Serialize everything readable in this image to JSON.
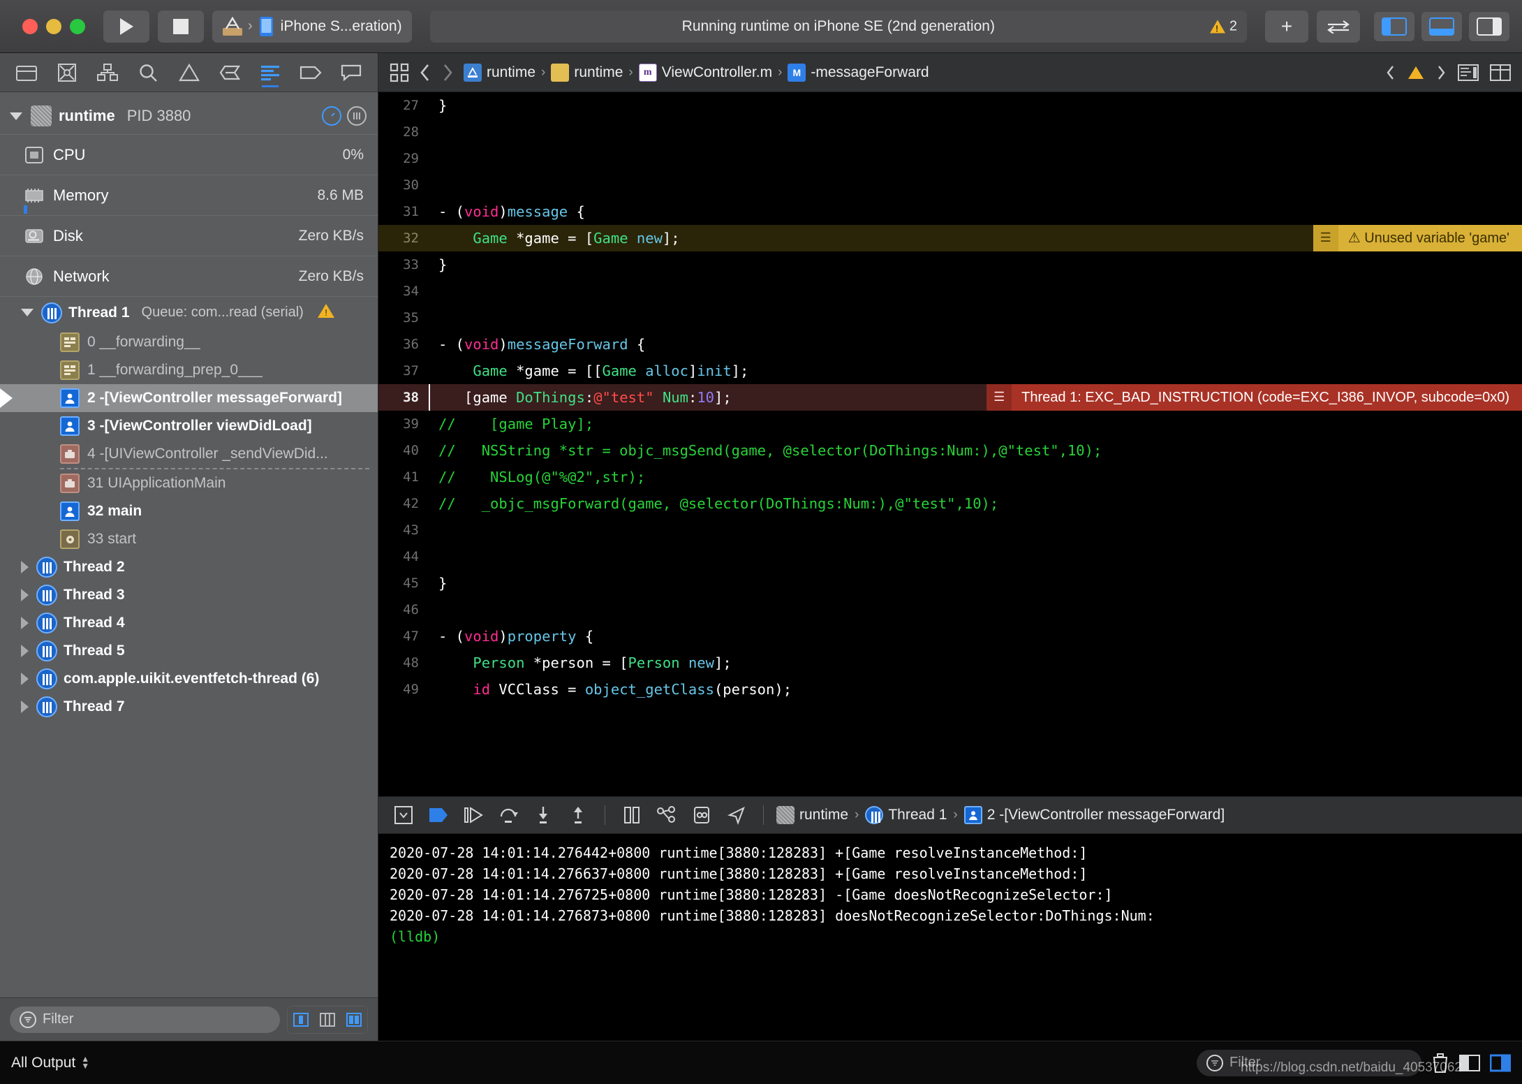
{
  "titlebar": {
    "play_icon": "play-icon",
    "stop_icon": "stop-icon",
    "scheme_name": "iPhone S...eration)",
    "status_text": "Running runtime on iPhone SE (2nd generation)",
    "warning_count": "2",
    "add_label": "+",
    "swap_icon": "swap-icon"
  },
  "navigator": {
    "toolbar_icons": [
      "folder-icon",
      "source-control-icon",
      "hierarchy-icon",
      "search-icon",
      "warning-icon",
      "breakpoint-icon",
      "debug-icon",
      "bookmark-icon",
      "comment-icon"
    ],
    "process": {
      "name": "runtime",
      "pid": "PID 3880"
    },
    "gauges": [
      {
        "label": "CPU",
        "value": "0%",
        "icon": "cpu-icon"
      },
      {
        "label": "Memory",
        "value": "8.6 MB",
        "icon": "memory-icon"
      },
      {
        "label": "Disk",
        "value": "Zero KB/s",
        "icon": "disk-icon"
      },
      {
        "label": "Network",
        "value": "Zero KB/s",
        "icon": "network-icon"
      }
    ],
    "thread1": {
      "name": "Thread 1",
      "queue": "Queue: com...read (serial)"
    },
    "frames": [
      {
        "index": "0",
        "label": "__forwarding__",
        "kind": "lib",
        "dim": true
      },
      {
        "index": "1",
        "label": "__forwarding_prep_0___",
        "kind": "lib",
        "dim": true
      },
      {
        "index": "2",
        "label": "-[ViewController messageForward]",
        "kind": "user",
        "dim": false,
        "selected": true
      },
      {
        "index": "3",
        "label": "-[ViewController viewDidLoad]",
        "kind": "user",
        "dim": false
      },
      {
        "index": "4",
        "label": "-[UIViewController _sendViewDid...",
        "kind": "sys",
        "dim": true
      },
      {
        "index": "31",
        "label": "UIApplicationMain",
        "kind": "sys",
        "dim": true
      },
      {
        "index": "32",
        "label": "main",
        "kind": "user",
        "dim": false
      },
      {
        "index": "33",
        "label": "start",
        "kind": "gear",
        "dim": true
      }
    ],
    "other_threads": [
      "Thread 2",
      "Thread 3",
      "Thread 4",
      "Thread 5",
      "com.apple.uikit.eventfetch-thread (6)",
      "Thread 7"
    ],
    "filter_placeholder": "Filter"
  },
  "jumpbar": {
    "crumbs": [
      {
        "label": "runtime",
        "icon": "project-icon"
      },
      {
        "label": "runtime",
        "icon": "folder-icon"
      },
      {
        "label": "ViewController.m",
        "icon": "objc-file-icon"
      },
      {
        "label": "-messageForward",
        "icon": "method-icon"
      }
    ]
  },
  "editor": {
    "lines": [
      {
        "n": "27",
        "state": "normal",
        "tokens": [
          {
            "t": "}",
            "c": "pln"
          }
        ]
      },
      {
        "n": "28",
        "state": "normal",
        "tokens": []
      },
      {
        "n": "29",
        "state": "normal",
        "tokens": []
      },
      {
        "n": "30",
        "state": "normal",
        "tokens": []
      },
      {
        "n": "31",
        "state": "normal",
        "tokens": [
          {
            "t": "- (",
            "c": "pln"
          },
          {
            "t": "void",
            "c": "kw"
          },
          {
            "t": ")",
            "c": "pln"
          },
          {
            "t": "message",
            "c": "meth"
          },
          {
            "t": " {",
            "c": "pln"
          }
        ]
      },
      {
        "n": "32",
        "state": "warn",
        "tokens": [
          {
            "t": "    ",
            "c": "pln"
          },
          {
            "t": "Game",
            "c": "type"
          },
          {
            "t": " *game = [",
            "c": "pln"
          },
          {
            "t": "Game",
            "c": "type"
          },
          {
            "t": " ",
            "c": "pln"
          },
          {
            "t": "new",
            "c": "meth"
          },
          {
            "t": "];",
            "c": "pln"
          }
        ]
      },
      {
        "n": "33",
        "state": "normal",
        "tokens": [
          {
            "t": "}",
            "c": "pln"
          }
        ]
      },
      {
        "n": "34",
        "state": "normal",
        "tokens": []
      },
      {
        "n": "35",
        "state": "normal",
        "tokens": []
      },
      {
        "n": "36",
        "state": "normal",
        "tokens": [
          {
            "t": "- (",
            "c": "pln"
          },
          {
            "t": "void",
            "c": "kw"
          },
          {
            "t": ")",
            "c": "pln"
          },
          {
            "t": "messageForward",
            "c": "meth"
          },
          {
            "t": " {",
            "c": "pln"
          }
        ]
      },
      {
        "n": "37",
        "state": "normal",
        "tokens": [
          {
            "t": "    ",
            "c": "pln"
          },
          {
            "t": "Game",
            "c": "type"
          },
          {
            "t": " *game = [[",
            "c": "pln"
          },
          {
            "t": "Game",
            "c": "type"
          },
          {
            "t": " ",
            "c": "pln"
          },
          {
            "t": "alloc",
            "c": "meth"
          },
          {
            "t": "]",
            "c": "pln"
          },
          {
            "t": "init",
            "c": "meth"
          },
          {
            "t": "];",
            "c": "pln"
          }
        ]
      },
      {
        "n": "38",
        "state": "err",
        "tokens": [
          {
            "t": "   [game ",
            "c": "pln"
          },
          {
            "t": "DoThings",
            "c": "type"
          },
          {
            "t": ":",
            "c": "pln"
          },
          {
            "t": "@\"test\"",
            "c": "str"
          },
          {
            "t": " ",
            "c": "pln"
          },
          {
            "t": "Num",
            "c": "type"
          },
          {
            "t": ":",
            "c": "pln"
          },
          {
            "t": "10",
            "c": "num"
          },
          {
            "t": "];",
            "c": "pln"
          }
        ]
      },
      {
        "n": "39",
        "state": "normal",
        "tokens": [
          {
            "t": "//    [game Play];",
            "c": "cmt"
          }
        ]
      },
      {
        "n": "40",
        "state": "normal",
        "tokens": [
          {
            "t": "//   NSString *str = objc_msgSend(game, @selector(DoThings:Num:),@\"test\",10);",
            "c": "cmt"
          }
        ]
      },
      {
        "n": "41",
        "state": "normal",
        "tokens": [
          {
            "t": "//    NSLog(@\"%@2\",str);",
            "c": "cmt"
          }
        ]
      },
      {
        "n": "42",
        "state": "normal",
        "tokens": [
          {
            "t": "//   _objc_msgForward(game, @selector(DoThings:Num:),@\"test\",10);",
            "c": "cmt"
          }
        ]
      },
      {
        "n": "43",
        "state": "normal",
        "tokens": []
      },
      {
        "n": "44",
        "state": "normal",
        "tokens": []
      },
      {
        "n": "45",
        "state": "normal",
        "tokens": [
          {
            "t": "}",
            "c": "pln"
          }
        ]
      },
      {
        "n": "46",
        "state": "normal",
        "tokens": []
      },
      {
        "n": "47",
        "state": "normal",
        "tokens": [
          {
            "t": "- (",
            "c": "pln"
          },
          {
            "t": "void",
            "c": "kw"
          },
          {
            "t": ")",
            "c": "pln"
          },
          {
            "t": "property",
            "c": "meth"
          },
          {
            "t": " {",
            "c": "pln"
          }
        ]
      },
      {
        "n": "48",
        "state": "normal",
        "tokens": [
          {
            "t": "    ",
            "c": "pln"
          },
          {
            "t": "Person",
            "c": "type"
          },
          {
            "t": " *person = [",
            "c": "pln"
          },
          {
            "t": "Person",
            "c": "type"
          },
          {
            "t": " ",
            "c": "pln"
          },
          {
            "t": "new",
            "c": "meth"
          },
          {
            "t": "];",
            "c": "pln"
          }
        ]
      },
      {
        "n": "49",
        "state": "normal",
        "tokens": [
          {
            "t": "    ",
            "c": "pln"
          },
          {
            "t": "id",
            "c": "kw"
          },
          {
            "t": " VCClass = ",
            "c": "pln"
          },
          {
            "t": "object_getClass",
            "c": "meth"
          },
          {
            "t": "(person);",
            "c": "pln"
          }
        ]
      }
    ],
    "warning_banner": "Unused variable 'game'",
    "error_banner": "Thread 1: EXC_BAD_INSTRUCTION (code=EXC_I386_INVOP, subcode=0x0)"
  },
  "debugbar": {
    "icons": [
      "hide-debug-area-icon",
      "breakpoints-activate-icon",
      "continue-icon",
      "step-over-icon",
      "step-into-icon",
      "step-out-icon",
      "view-debug-icon",
      "view-hierarchy-icon",
      "memory-graph-icon",
      "location-simulate-icon"
    ],
    "crumbs": [
      {
        "label": "runtime",
        "icon": "process-icon"
      },
      {
        "label": "Thread 1",
        "icon": "thread-icon"
      },
      {
        "label": "2 -[ViewController messageForward]",
        "icon": "frame-icon"
      }
    ]
  },
  "console": {
    "lines": [
      "2020-07-28 14:01:14.276442+0800 runtime[3880:128283] +[Game resolveInstanceMethod:]",
      "2020-07-28 14:01:14.276637+0800 runtime[3880:128283] +[Game resolveInstanceMethod:]",
      "2020-07-28 14:01:14.276725+0800 runtime[3880:128283] -[Game doesNotRecognizeSelector:]",
      "2020-07-28 14:01:14.276873+0800 runtime[3880:128283] doesNotRecognizeSelector:DoThings:Num:"
    ],
    "prompt": "(lldb)"
  },
  "bottombar": {
    "output_scope": "All Output",
    "filter_placeholder": "Filter",
    "watermark": "https://blog.csdn.net/baidu_40537062",
    "trash_icon": "trash-icon"
  },
  "colors": {
    "accent_blue": "#2f7fe8",
    "warning_yellow": "#d9b136",
    "error_red": "#a93226",
    "comment_green": "#27d338",
    "type_green": "#41e086",
    "keyword_pink": "#ff2d92",
    "string_red": "#ff4b4b",
    "number_purple": "#8f7bf7",
    "method_cyan": "#67c6e8"
  }
}
